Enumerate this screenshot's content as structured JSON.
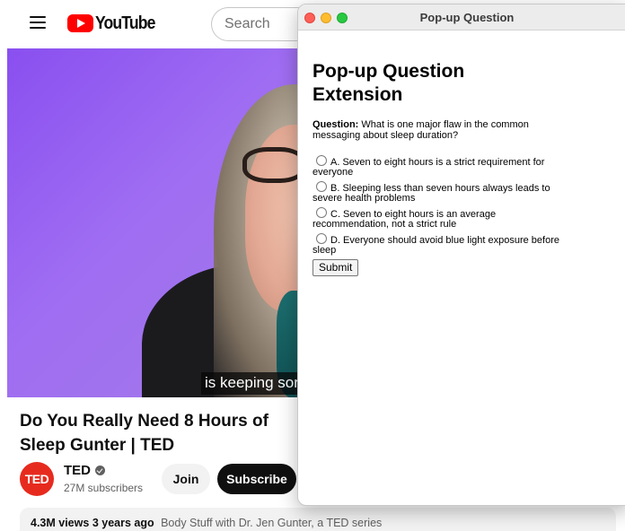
{
  "youtube": {
    "logo_text": "YouTube",
    "search_placeholder": "Search",
    "caption": "is keeping sor",
    "video_title": "Do You Really Need 8 Hours of Sleep Gunter | TED",
    "channel": {
      "avatar_text": "TED",
      "name": "TED",
      "subscribers": "27M subscribers",
      "join_label": "Join",
      "subscribe_label": "Subscribe"
    },
    "description": {
      "views": "4.3M views",
      "age": "3 years ago",
      "series": "Body Stuff with Dr. Jen Gunter, a TED series"
    },
    "colors": {
      "brand_red": "#ff0000",
      "ted_red": "#e62b1e"
    }
  },
  "popup": {
    "window_title": "Pop-up Question",
    "heading": "Pop-up Question Extension",
    "question_label": "Question:",
    "question_text": "What is one major flaw in the common messaging about sleep duration?",
    "options": [
      "A. Seven to eight hours is a strict requirement for everyone",
      "B. Sleeping less than seven hours always leads to severe health problems",
      "C. Seven to eight hours is an average recommendation, not a strict rule",
      "D. Everyone should avoid blue light exposure before sleep"
    ],
    "submit_label": "Submit",
    "traffic_lights": {
      "close": "#ff5f57",
      "minimize": "#febc2e",
      "maximize": "#28c840"
    }
  }
}
